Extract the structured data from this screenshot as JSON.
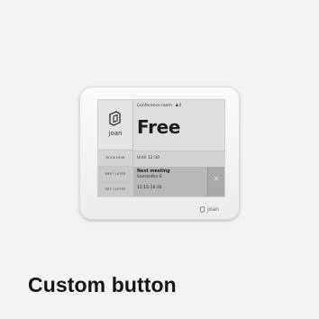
{
  "device": {
    "room_label": "Conference room",
    "room_capacity": "4",
    "brand_logo_text": "joan",
    "status": "Free",
    "until": "Until 12:30",
    "side_buttons": [
      "BOOK NOW",
      "MEET LATER",
      "GET COFFEE"
    ],
    "next_meeting": {
      "title": "Next meeting",
      "person": "Samantha S.",
      "time": "15:15-16:30"
    },
    "footer_brand": "joan"
  },
  "caption": {
    "title": "Custom button"
  },
  "icons": {
    "logo": "joan-logo-icon",
    "people": "people-icon",
    "close": "close-icon"
  }
}
